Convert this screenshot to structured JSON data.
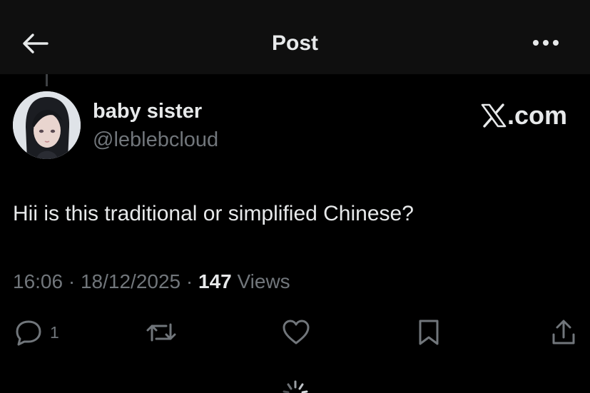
{
  "header": {
    "title": "Post",
    "back_icon": "arrow-left-icon",
    "more_icon": "ellipsis-icon"
  },
  "post": {
    "author": {
      "display_name": "baby sister",
      "handle": "@leblebcloud"
    },
    "watermark": {
      "text": ".com",
      "logo_icon": "x-logo-icon"
    },
    "text": "Hii is this traditional or simplified Chinese?",
    "meta": {
      "time": "16:06",
      "separator": "·",
      "date": "18/12/2025",
      "views_count": "147",
      "views_label": "Views"
    },
    "actions": {
      "reply_count": "1",
      "icons": [
        "reply-icon",
        "repost-icon",
        "like-icon",
        "bookmark-icon",
        "share-icon"
      ]
    }
  },
  "colors": {
    "background": "#000000",
    "header_background": "#0f0f0f",
    "primary_text": "#e7e9ea",
    "secondary_text": "#71767b"
  }
}
